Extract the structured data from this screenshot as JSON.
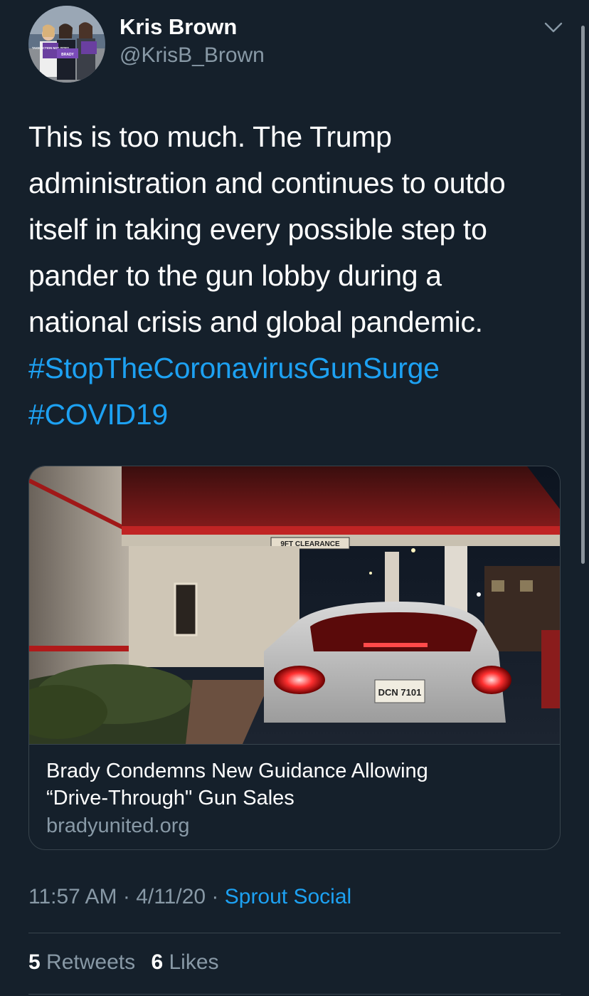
{
  "user": {
    "display_name": "Kris Brown",
    "handle": "@KrisB_Brown",
    "avatar_sign_text": "TAKE ACTION NOT SIDES",
    "avatar_sign_brand": "BRADY"
  },
  "tweet": {
    "lines": [
      "This is too much. The Trump",
      "administration and continues to outdo",
      "itself in taking every possible step to",
      "pander to the gun lobby during a",
      "national crisis and global pandemic."
    ],
    "hashtags": [
      "#StopTheCoronavirusGunSurge",
      "#COVID19"
    ]
  },
  "card": {
    "image_sign_text": "9FT CLEARANCE",
    "image_plate_text": "DCN 7101",
    "title_line1": "Brady Condemns New Guidance Allowing",
    "title_line2": "“Drive-Through\" Gun Sales",
    "domain": "bradyunited.org"
  },
  "meta": {
    "time": "11:57 AM",
    "date": "4/11/20",
    "separator": " · ",
    "source": "Sprout Social"
  },
  "stats": {
    "retweets_count": "5",
    "retweets_label": "Retweets",
    "likes_count": "6",
    "likes_label": "Likes"
  },
  "colors": {
    "background": "#15202b",
    "link": "#1da1f2",
    "secondary_text": "#8899a6",
    "border": "#38444d"
  },
  "icons": [
    "chevron-down-icon"
  ]
}
